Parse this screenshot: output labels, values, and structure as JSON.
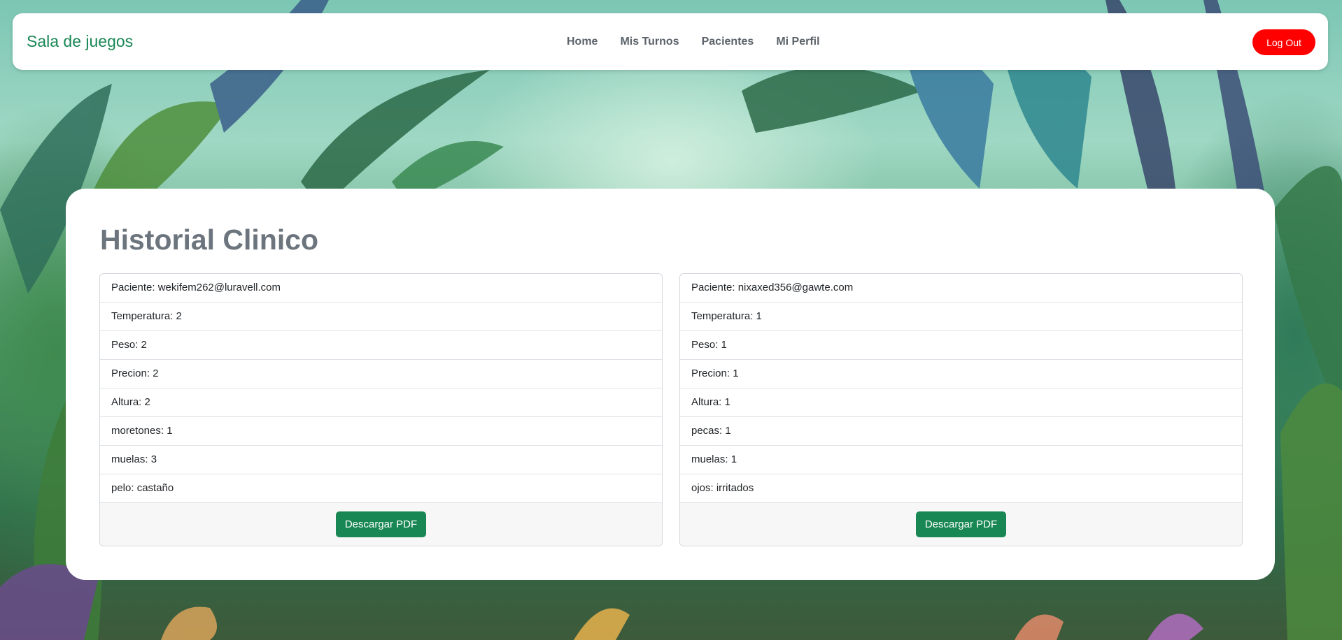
{
  "navbar": {
    "brand": "Sala de juegos",
    "links": [
      "Home",
      "Mis Turnos",
      "Pacientes",
      "Mi Perfil"
    ],
    "logout_label": "Log Out"
  },
  "main": {
    "title": "Historial Clinico",
    "records": [
      {
        "rows": [
          "Paciente: wekifem262@luravell.com",
          "Temperatura: 2",
          "Peso: 2",
          "Precion: 2",
          "Altura: 2",
          "moretones: 1",
          "muelas: 3",
          "pelo: castaño"
        ],
        "download_label": "Descargar PDF"
      },
      {
        "rows": [
          "Paciente: nixaxed356@gawte.com",
          "Temperatura: 1",
          "Peso: 1",
          "Precion: 1",
          "Altura: 1",
          "pecas: 1",
          "muelas: 1",
          "ojos: irritados"
        ],
        "download_label": "Descargar PDF"
      }
    ]
  },
  "colors": {
    "brand": "#198754",
    "logout": "#ff0000",
    "download": "#198754",
    "title": "#6c757d"
  }
}
